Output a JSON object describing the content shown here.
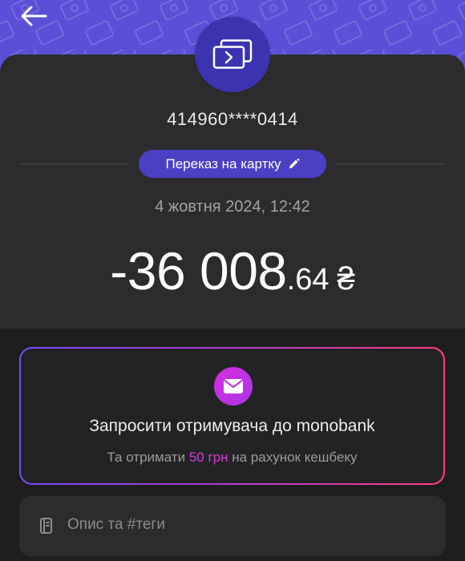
{
  "transaction": {
    "card_number": "414960****0414",
    "type_label": "Переказ на картку",
    "datetime": "4 жовтня 2024, 12:42",
    "amount": {
      "integer": "-36 008",
      "fraction": ".64",
      "currency": "₴"
    }
  },
  "invite": {
    "title": "Запросити отримувача до monobank",
    "subtitle_prefix": "Та отримати ",
    "subtitle_accent": "50 грн",
    "subtitle_suffix": " на рахунок кешбеку"
  },
  "description": {
    "placeholder": "Опис та #теги"
  },
  "icons": {
    "back": "arrow-left-icon",
    "avatar": "card-transfer-icon",
    "chip": "pencil-icon",
    "invite": "envelope-icon",
    "description": "note-icon"
  },
  "colors": {
    "header": "#5a4fd6",
    "sheet": "#2c2c2e",
    "background": "#1e1e1f",
    "chip": "#4b3fc4",
    "avatar": "#3b33b0",
    "accent_pink": "#d53bd8"
  }
}
